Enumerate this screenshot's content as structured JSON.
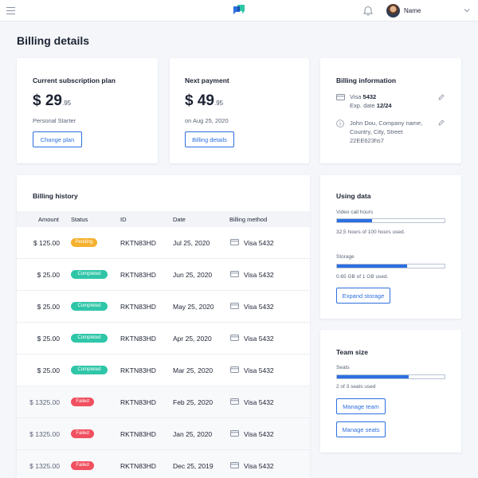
{
  "header": {
    "user_name": "Name"
  },
  "page": {
    "title": "Billing details"
  },
  "subscription": {
    "title": "Current subscription plan",
    "amount": "$ 29",
    "cents": ".95",
    "plan_name": "Personal Starter",
    "button": "Change plan"
  },
  "next_payment": {
    "title": "Next payment",
    "amount": "$ 49",
    "cents": ".95",
    "date": "on Aug 25, 2020",
    "button": "Billing details"
  },
  "billing_info": {
    "title": "Billing information",
    "card_label": "Visa ",
    "card_number": "5432",
    "exp_label": "Exp. date ",
    "exp_date": "12/24",
    "address_line1": "John Dou, Company name,",
    "address_line2": "Country, City, Street",
    "address_line3": "22EE623hs7"
  },
  "history": {
    "title": "Billing history",
    "columns": {
      "amount": "Amount",
      "status": "Status",
      "id": "ID",
      "date": "Date",
      "method": "Billing method"
    },
    "rows": [
      {
        "amount": "$ 125.00",
        "status": "Pending",
        "id": "RKTN83HD",
        "date": "Jul 25, 2020",
        "method": "Visa 5432"
      },
      {
        "amount": "$ 25.00",
        "status": "Completed",
        "id": "RKTN83HD",
        "date": "Jun 25, 2020",
        "method": "Visa 5432"
      },
      {
        "amount": "$ 25.00",
        "status": "Completed",
        "id": "RKTN83HD",
        "date": "May 25, 2020",
        "method": "Visa 5432"
      },
      {
        "amount": "$ 25.00",
        "status": "Completed",
        "id": "RKTN83HD",
        "date": "Apr 25, 2020",
        "method": "Visa 5432"
      },
      {
        "amount": "$ 25.00",
        "status": "Completed",
        "id": "RKTN83HD",
        "date": "Mar 25, 2020",
        "method": "Visa 5432"
      },
      {
        "amount": "$ 1325.00",
        "status": "Failed",
        "id": "RKTN83HD",
        "date": "Feb 25, 2020",
        "method": "Visa 5432"
      },
      {
        "amount": "$ 1325.00",
        "status": "Failed",
        "id": "RKTN83HD",
        "date": "Jan 25, 2020",
        "method": "Visa 5432"
      },
      {
        "amount": "$ 1325.00",
        "status": "Failed",
        "id": "RKTN83HD",
        "date": "Dec 25, 2019",
        "method": "Visa 5432"
      }
    ]
  },
  "using_data": {
    "title": "Using data",
    "video_label": "Video call hours",
    "video_progress": 0.325,
    "video_note": "32,5 hours of 100 hours used.",
    "storage_label": "Storage",
    "storage_progress": 0.65,
    "storage_note": "0.65 GB of 1 GB used.",
    "button": "Expand storage"
  },
  "team_size": {
    "title": "Team size",
    "seats_label": "Seats",
    "seats_progress": 0.6667,
    "seats_note": "2 of 3 seats used",
    "manage_team": "Manage team",
    "manage_seats": "Manage seats"
  },
  "colors": {
    "accent": "#2d6fe0",
    "pending": "#f5b12e",
    "completed": "#2fc6a8",
    "failed": "#f0505f"
  },
  "icons": [
    "menu-icon",
    "app-logo-icon",
    "bell-icon",
    "chevron-down-icon",
    "credit-card-icon",
    "info-icon",
    "pencil-icon"
  ]
}
